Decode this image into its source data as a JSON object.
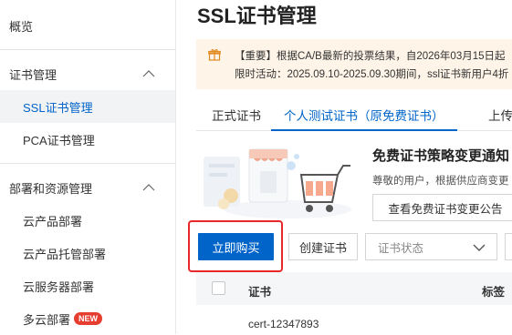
{
  "sidebar": {
    "overview": "概览",
    "cert_group": "证书管理",
    "ssl_item": "SSL证书管理",
    "pca_item": "PCA证书管理",
    "deploy_group": "部署和资源管理",
    "cloud_product": "云产品部署",
    "cloud_hosted": "云产品托管部署",
    "cloud_server": "云服务器部署",
    "multi_cloud": "多云部署",
    "new_badge": "NEW"
  },
  "main": {
    "title": "SSL证书管理",
    "notice": {
      "line1": "【重要】根据CA/B最新的投票结果，自2026年03月15日起",
      "line2": "限时活动：2025.09.10-2025.09.30期间，ssl证书新用户4折"
    },
    "tabs": [
      "正式证书",
      "个人测试证书（原免费证书）",
      "上传"
    ],
    "banner": {
      "title": "免费证书策略变更通知",
      "text": "尊敬的用户，根据供应商变更",
      "link": "查看免费证书变更公告"
    },
    "toolbar": {
      "buy": "立即购买",
      "create": "创建证书",
      "status_placeholder": "证书状态"
    },
    "table": {
      "columns": [
        "证书",
        "标签"
      ],
      "rows": [
        {
          "cert": "cert-12347893"
        }
      ]
    }
  },
  "colors": {
    "primary": "#0064c8",
    "highlight": "#e8282b",
    "notice_bg": "#fff4e8",
    "badge": "#e53e30"
  }
}
